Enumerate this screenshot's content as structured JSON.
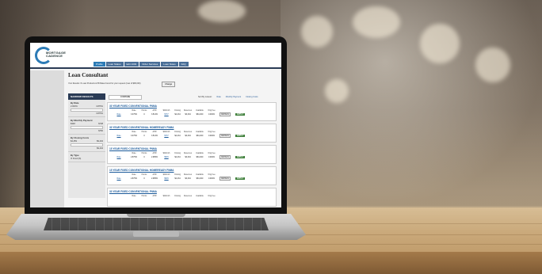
{
  "app": {
    "logo_line1": "MORTGAGE",
    "logo_line2": "CADENCE",
    "nav": [
      "Profile",
      "Loan Status",
      "Edit 1003",
      "Order Services",
      "Loan Notes",
      "FAQ"
    ],
    "page_title": "Loan Consultant",
    "subtitle": "Your Results: 6 Loan Products & 58 Rates found for your request (max of $96,000)",
    "change_label": "Change"
  },
  "sidebar": {
    "header": "NARROW RESULTS",
    "sections": [
      {
        "title": "By Rate",
        "rows": [
          [
            "2.000%",
            "3.875%"
          ],
          [
            "",
            "3.875%"
          ]
        ]
      },
      {
        "title": "By Monthly Payment",
        "rows": [
          [
            "$348",
            "$738"
          ],
          [
            "",
            "$750"
          ]
        ]
      },
      {
        "title": "By Closing Costs",
        "rows": [
          [
            "$4,459",
            "$9,404"
          ],
          [
            "",
            "$9,404"
          ]
        ]
      },
      {
        "title": "By Type",
        "rows": [
          [
            "Fixed (6)",
            ""
          ]
        ]
      }
    ]
  },
  "toolbar": {
    "compare_label": "COMPARE",
    "sort_label": "Sort By Lowest:",
    "sort_options": [
      "Rate",
      "Monthly Payment",
      "Closing Costs"
    ]
  },
  "columns": [
    "",
    "Rate",
    "Points",
    "APR",
    "$/Month",
    "Closing",
    "Reserves",
    "Available",
    "Orig Fee",
    "",
    ""
  ],
  "products": [
    {
      "name": "30 YEAR FIXED CONVENTIONAL FNMA",
      "row": [
        "Rate",
        "3.375%",
        "0",
        "3.513%",
        "$737",
        "$4,434",
        "$3,304",
        "$81,000",
        "0.000%"
      ]
    },
    {
      "name": "30 YEAR FIXED CONVENTIONAL HOMEREADY FNMA",
      "row": [
        "Rate",
        "3.375%",
        "0",
        "3.513%",
        "$737",
        "$4,434",
        "$3,304",
        "$81,000",
        "0.000%"
      ]
    },
    {
      "name": "15 YEAR FIXED CONVENTIONAL FNMA",
      "row": [
        "Rate",
        "2.875%",
        "0",
        "2.985%",
        "$545",
        "$4,434",
        "$3,304",
        "$81,000",
        "0.000%"
      ]
    },
    {
      "name": "15 YEAR FIXED CONVENTIONAL HOMEREADY FNMA",
      "row": [
        "Rate",
        "2.875%",
        "0",
        "2.985%",
        "$545",
        "$4,434",
        "$3,304",
        "$81,000",
        "0.000%"
      ]
    },
    {
      "name": "30 YEAR FIXED CONVENTIONAL FNMA",
      "row": [
        "",
        "",
        "",
        "",
        "",
        "",
        "",
        "",
        ""
      ]
    }
  ],
  "actions": {
    "details_label": "DETAILS",
    "apply_label": "APPLY"
  }
}
